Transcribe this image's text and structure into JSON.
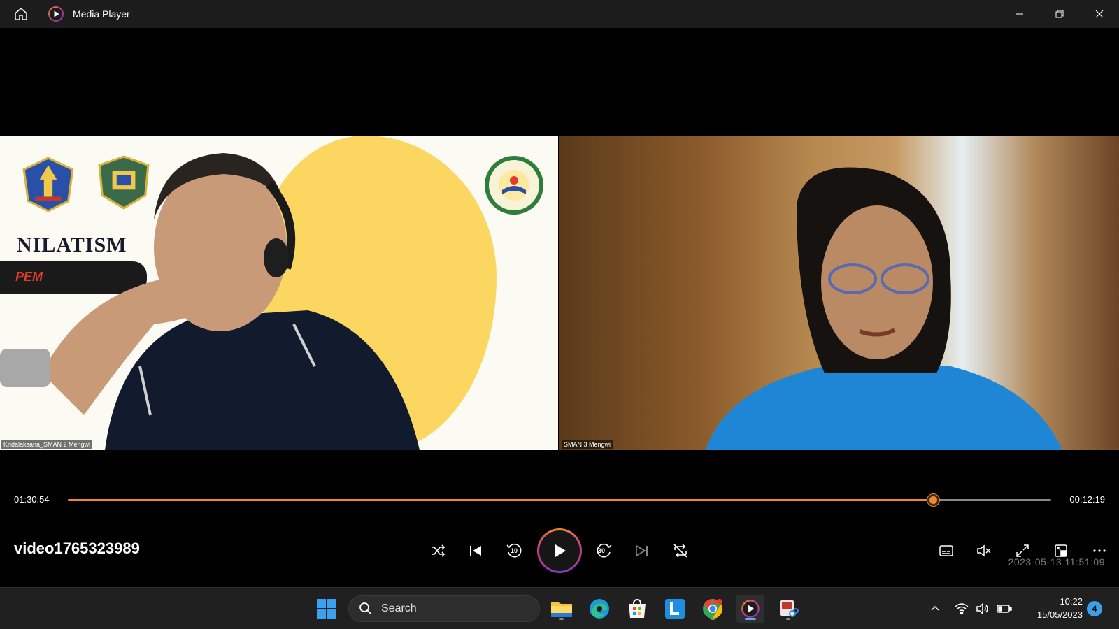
{
  "window": {
    "title": "Media Player",
    "controls": [
      "minimize",
      "restore",
      "close"
    ]
  },
  "video": {
    "left_panel": {
      "participant_name": "Kridalaksana_SMAN 2 Mengwi",
      "slide_title": "NILATISM",
      "slide_banner": "PEM"
    },
    "right_panel": {
      "participant_name": "SMAN 3 Mengwi"
    }
  },
  "playback": {
    "elapsed": "01:30:54",
    "remaining": "00:12:19",
    "progress_fraction": 0.88,
    "title": "video1765323989",
    "watermark": "2023-05-13  11:51:09"
  },
  "controls": {
    "shuffle": "shuffle-icon",
    "previous": "previous-icon",
    "skip_back": "10",
    "play": "play-icon",
    "skip_forward": "30",
    "next": "next-icon",
    "repeat": "repeat-off-icon",
    "right": [
      "captions-icon",
      "mute-icon",
      "fullscreen-icon",
      "miniplayer-icon",
      "more-icon"
    ]
  },
  "taskbar": {
    "search_placeholder": "Search",
    "apps": [
      "windows-start",
      "file-explorer",
      "edge",
      "microsoft-store",
      "l-app",
      "chrome",
      "media-player",
      "snipping-tool"
    ],
    "clock_time": "10:22",
    "clock_date": "15/05/2023",
    "notification_count": "4"
  },
  "colors": {
    "accent": "#f08a2a",
    "title_bar": "#1c1c1c",
    "taskbar": "#202020",
    "slide_yellow": "#fbd762"
  }
}
